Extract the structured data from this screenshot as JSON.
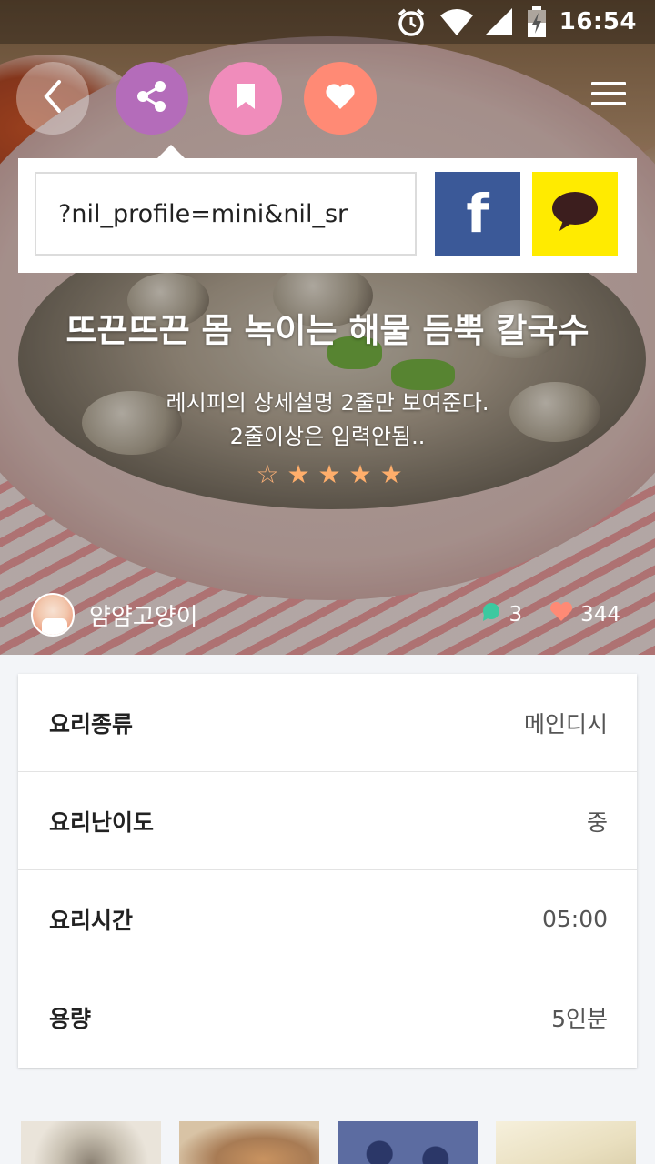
{
  "status_bar": {
    "time": "16:54"
  },
  "share": {
    "url_text": "?nil_profile=mini&nil_sr",
    "facebook_label": "f"
  },
  "recipe": {
    "title": "뜨끈뜨끈 몸 녹이는 해물 듬뿍 칼국수",
    "description_line1": "레시피의 상세설명 2줄만 보여준다.",
    "description_line2": "2줄이상은 입력안됨..",
    "rating": 4,
    "rating_max": 5,
    "author": "얌얌고양이",
    "comment_count": "3",
    "like_count": "344"
  },
  "info": [
    {
      "label": "요리종류",
      "value": "메인디시"
    },
    {
      "label": "요리난이도",
      "value": "중"
    },
    {
      "label": "요리시간",
      "value": "05:00"
    },
    {
      "label": "용량",
      "value": "5인분"
    }
  ],
  "icons": {
    "back": "chevron-left-icon",
    "share": "share-icon",
    "bookmark": "bookmark-icon",
    "like": "heart-icon",
    "menu": "hamburger-menu-icon",
    "kakao": "kakao-speech-bubble-icon",
    "comment": "comment-bubble-icon"
  },
  "colors": {
    "share_button": "#b46cba",
    "bookmark_button": "#f08cbb",
    "like_button": "#ff8a75",
    "facebook": "#3b5998",
    "kakao": "#ffeb00",
    "star": "#ffae6b",
    "comment_icon": "#3cc9a0",
    "heart_icon": "#ff8a75"
  }
}
